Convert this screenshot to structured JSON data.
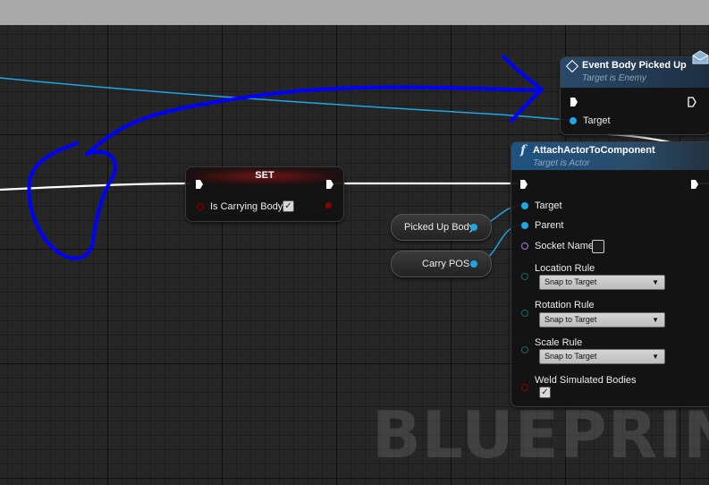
{
  "watermark": "BLUEPRINT",
  "colors": {
    "exec_wire": "#ffffff",
    "object_pin": "#1fa6e6",
    "bool_pin": "#8c0000",
    "string_pin": "#a87bd8",
    "enum_pin": "#0a6e62",
    "event_header": "#2b4a6a",
    "function_header": "#1e5280",
    "set_header": "#6e1414",
    "annotation": "#0000ff"
  },
  "event_node": {
    "title": "Event Body Picked Up",
    "subtitle": "Target is Enemy",
    "icon": "event-diamond-icon",
    "pin_target": "Target"
  },
  "set_node": {
    "title": "SET",
    "var_label": "Is Carrying Body",
    "checked": true
  },
  "var_nodes": {
    "picked_up_body": "Picked Up Body",
    "carry_pos": "Carry POS"
  },
  "function_node": {
    "icon": "function-f-icon",
    "icon_glyph": "f",
    "title": "AttachActorToComponent",
    "subtitle": "Target is Actor",
    "pins": {
      "target": "Target",
      "parent": "Parent",
      "socket_name": "Socket Name",
      "location_rule": "Location Rule",
      "rotation_rule": "Rotation Rule",
      "scale_rule": "Scale Rule",
      "weld": "Weld Simulated Bodies"
    },
    "location_value": "Snap to Target",
    "rotation_value": "Snap to Target",
    "scale_value": "Snap to Target",
    "weld_checked": true
  }
}
